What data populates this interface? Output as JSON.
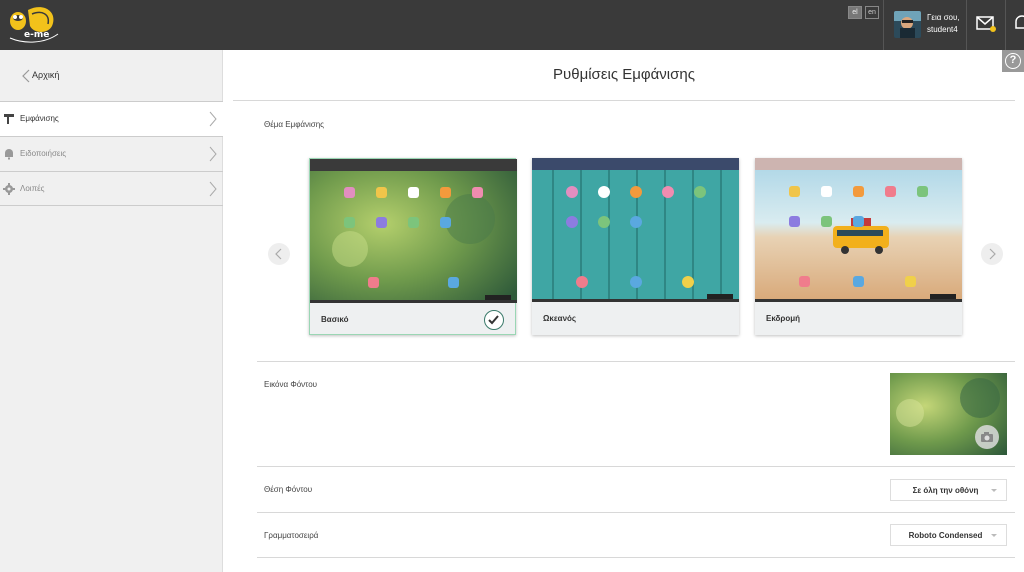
{
  "header": {
    "logo_text": "e-me",
    "languages": [
      "el",
      "en"
    ],
    "greeting": "Γεια σου,",
    "username": "student4"
  },
  "sidebar": {
    "back_label": "Αρχική",
    "items": [
      {
        "label": "Εμφάνισης",
        "icon": "paint-roller-icon",
        "active": true
      },
      {
        "label": "Ειδοποιήσεις",
        "icon": "bell-icon",
        "active": false
      },
      {
        "label": "Λοιπές",
        "icon": "gear-icon",
        "active": false
      }
    ]
  },
  "main": {
    "title": "Ρυθμίσεις Εμφάνισης",
    "help_label": "?",
    "theme_section_label": "Θέμα Εμφάνισης",
    "themes": [
      {
        "name": "Βασικό",
        "selected": true,
        "bar_color": "#3a3a3a"
      },
      {
        "name": "Ωκεανός",
        "selected": false,
        "bar_color": "#3b4a6b"
      },
      {
        "name": "Εκδρομή",
        "selected": false,
        "bar_color": "#cdb4b0"
      }
    ],
    "background_image_label": "Εικόνα Φόντου",
    "background_position_label": "Θέση Φόντου",
    "background_position_value": "Σε όλη την οθόνη",
    "font_label": "Γραμματοσειρά",
    "font_value": "Roboto Condensed"
  },
  "colors": {
    "topbar": "#3a3a3a",
    "sidebar": "#f0f0f0",
    "selected_border": "#9ad6b4",
    "check": "#3a7a6a"
  }
}
